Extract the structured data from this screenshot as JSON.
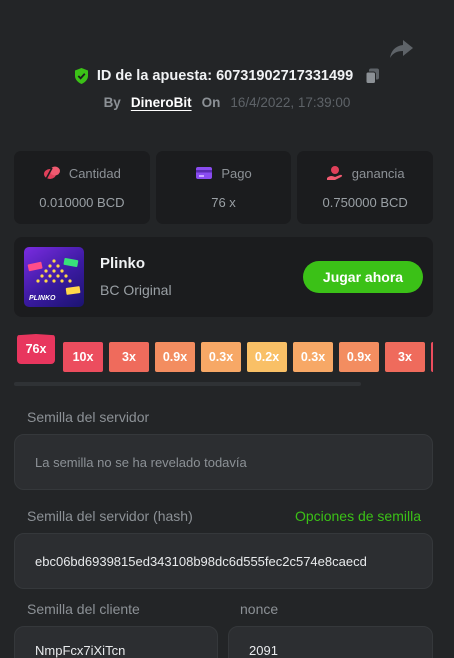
{
  "header": {
    "bet_id_label": "ID de la apuesta: 60731902717331499",
    "by_label": "By",
    "username": "DineroBit",
    "on_label": "On",
    "date": "16/4/2022, 17:39:00"
  },
  "stats": [
    {
      "label": "Cantidad",
      "value": "0.010000 BCD",
      "icon": "coins-icon"
    },
    {
      "label": "Pago",
      "value": "76 x",
      "icon": "card-icon"
    },
    {
      "label": "ganancia",
      "value": "0.750000 BCD",
      "icon": "profit-icon"
    }
  ],
  "game": {
    "title": "Plinko",
    "subtitle": "BC Original",
    "thumb_label": "PLINKO",
    "play_label": "Jugar ahora"
  },
  "multipliers": [
    "76x",
    "10x",
    "3x",
    "0.9x",
    "0.3x",
    "0.2x",
    "0.3x",
    "0.9x",
    "3x",
    ""
  ],
  "seeds": {
    "server_label": "Semilla del servidor",
    "server_placeholder": "La semilla no se ha revelado todavía",
    "hash_label": "Semilla del servidor (hash)",
    "seed_options_label": "Opciones de semilla",
    "hash_value": "ebc06bd6939815ed343108b98dc6d555fec2c574e8caecd",
    "client_label": "Semilla del cliente",
    "client_value": "NmpFcx7iXiTcn",
    "nonce_label": "nonce",
    "nonce_value": "2091"
  },
  "colors": {
    "accent_green": "#3bc117",
    "mult_first": "#e8365e",
    "mult_10x": "#ec4d5e",
    "mult_3x": "#ef6b5c",
    "mult_09x": "#f38d60",
    "mult_03x": "#f7a866",
    "mult_02x": "#f9c066"
  }
}
